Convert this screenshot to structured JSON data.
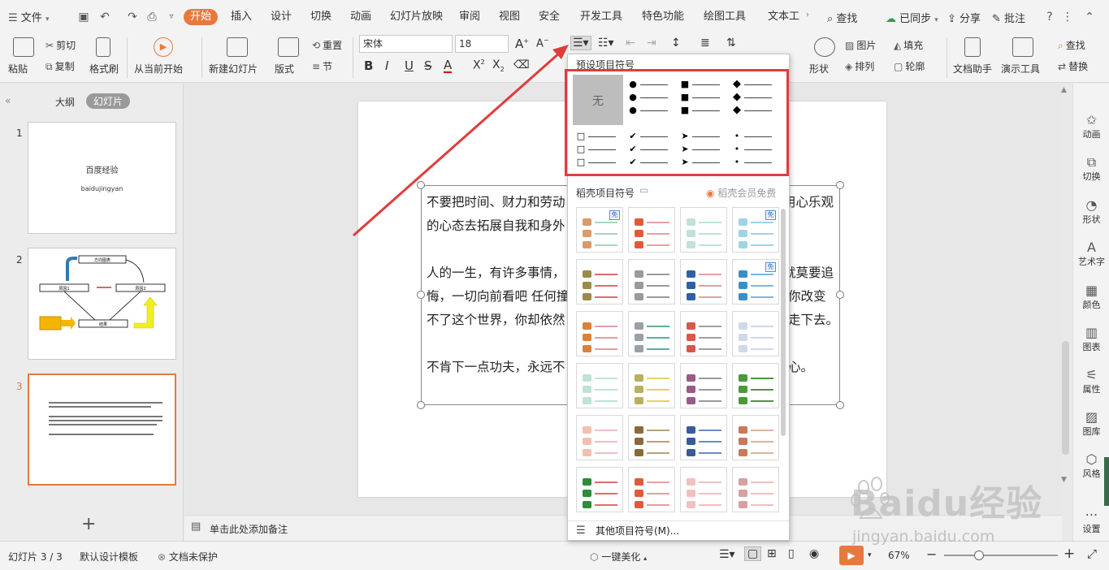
{
  "menubar": {
    "file_label": "文件",
    "tabs": [
      "开始",
      "插入",
      "设计",
      "切换",
      "动画",
      "幻灯片放映",
      "审阅",
      "视图",
      "安全",
      "开发工具",
      "特色功能",
      "绘图工具",
      "文本工"
    ],
    "search_label": "查找",
    "sync_label": "已同步",
    "share_label": "分享",
    "comment_label": "批注"
  },
  "ribbon": {
    "paste": "粘贴",
    "cut": "剪切",
    "copy": "复制",
    "format_painter": "格式刷",
    "from_current": "从当前开始",
    "new_slide": "新建幻灯片",
    "layout": "版式",
    "reset": "重置",
    "section": "节",
    "font_name": "宋体",
    "font_size": "18",
    "shape": "形状",
    "picture": "图片",
    "fill": "填充",
    "arrange": "排列",
    "outline": "轮廓",
    "doc_helper": "文档助手",
    "demo_tools": "演示工具",
    "find": "查找",
    "replace": "替换"
  },
  "leftpanel": {
    "tab_outline": "大纲",
    "tab_slides": "幻灯片",
    "slide_numbers": [
      "1",
      "2",
      "3"
    ],
    "slide1_title": "百度经验",
    "slide1_subtitle": "baidujingyan",
    "slide2_labels": [
      "方向图表",
      "原因1",
      "原因2",
      "结果"
    ],
    "add_slide": "+"
  },
  "slide": {
    "lines": [
      "不要把时间、财力和劳动",
      "的心态去拓展自我和身外",
      "人的一生，有许多事情，",
      "悔，一切向前看吧 任何撞",
      "不了这个世界，你却依然",
      "不肯下一点功夫，永远不"
    ],
    "right_lines": [
      "用心乐观",
      "就莫要追",
      "你改变",
      "走下去。",
      "心。"
    ]
  },
  "notes": {
    "placeholder": "单击此处添加备注"
  },
  "dropdown": {
    "preset_title": "预设项目符号",
    "none_label": "无",
    "wps_title": "稻壳项目符号",
    "member_label": "稻壳会员免费",
    "free_badge": "免",
    "more_label": "其他项目符号(M)..."
  },
  "rightbar": {
    "items": [
      "动画",
      "切换",
      "形状",
      "艺术字",
      "颜色",
      "图表",
      "属性",
      "图库",
      "风格",
      "设置"
    ]
  },
  "statusbar": {
    "slide_info": "幻灯片 3 / 3",
    "template": "默认设计模板",
    "protect": "文档未保护",
    "beautify": "一键美化",
    "zoom": "67%"
  },
  "watermark": {
    "brand": "Baidu经验",
    "url": "jingyan.baidu.com"
  },
  "colors": {
    "accent": "#e8793e",
    "highlight_red": "#e03c3c",
    "badge_blue": "#2f6cc0"
  }
}
